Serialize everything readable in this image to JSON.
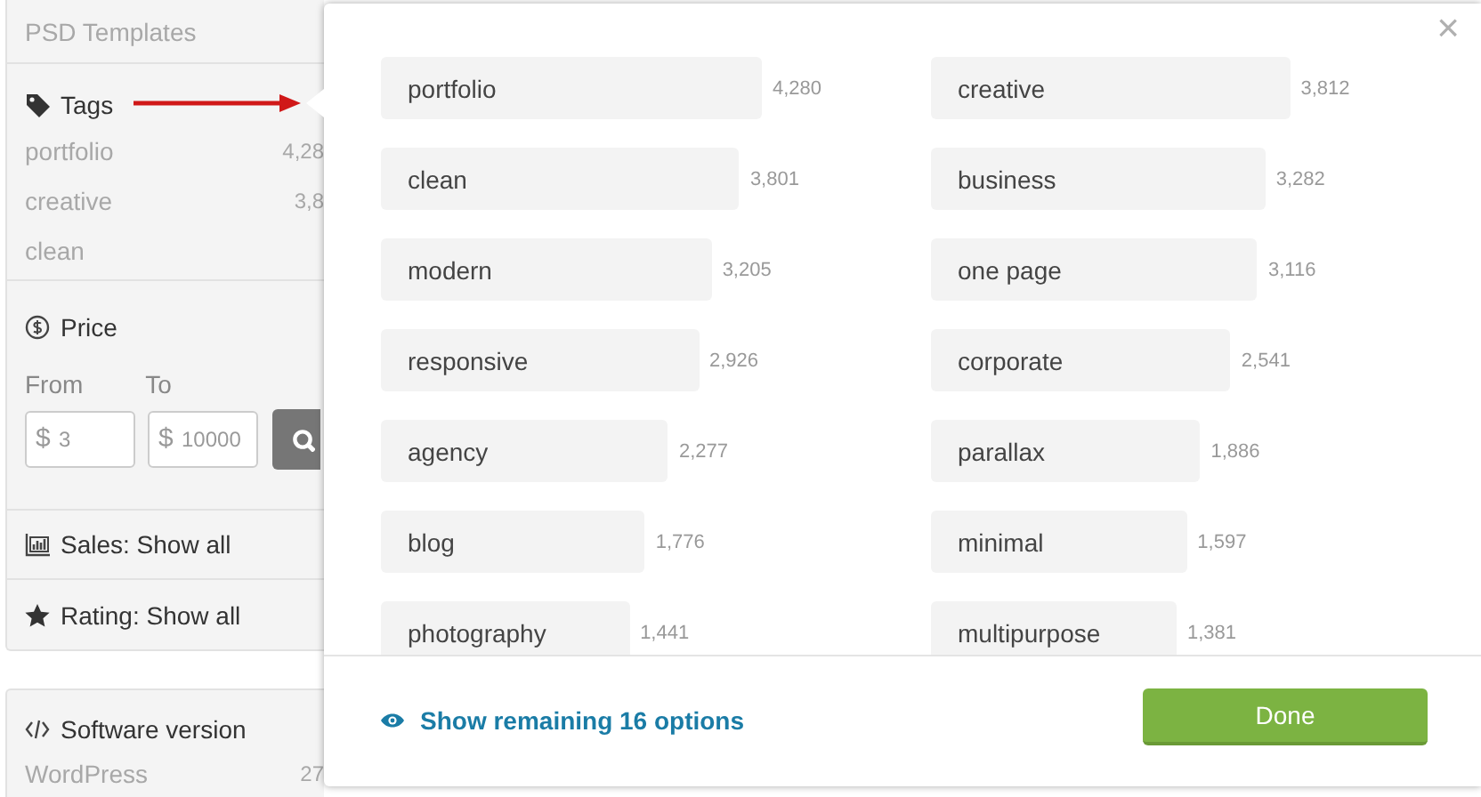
{
  "sidebar": {
    "category": {
      "label": "PSD Templates"
    },
    "tags": {
      "title": "Tags",
      "items": [
        {
          "label": "portfolio",
          "count": "4,28"
        },
        {
          "label": "creative",
          "count": "3,8"
        },
        {
          "label": "clean"
        }
      ]
    },
    "price": {
      "title": "Price",
      "from_label": "From",
      "to_label": "To",
      "from": {
        "currency": "$",
        "placeholder": "3"
      },
      "to": {
        "currency": "$",
        "placeholder": "10000"
      }
    },
    "sales": "Sales: Show all",
    "rating": "Rating: Show all",
    "software": {
      "title": "Software version",
      "items": [
        {
          "label": "WordPress",
          "count": "27"
        }
      ]
    }
  },
  "modal": {
    "close": "×",
    "tags": [
      {
        "label": "portfolio",
        "count": "4,280"
      },
      {
        "label": "creative",
        "count": "3,812"
      },
      {
        "label": "clean",
        "count": "3,801"
      },
      {
        "label": "business",
        "count": "3,282"
      },
      {
        "label": "modern",
        "count": "3,205"
      },
      {
        "label": "one page",
        "count": "3,116"
      },
      {
        "label": "responsive",
        "count": "2,926"
      },
      {
        "label": "corporate",
        "count": "2,541"
      },
      {
        "label": "agency",
        "count": "2,277"
      },
      {
        "label": "parallax",
        "count": "1,886"
      },
      {
        "label": "blog",
        "count": "1,776"
      },
      {
        "label": "minimal",
        "count": "1,597"
      },
      {
        "label": "photography",
        "count": "1,441"
      },
      {
        "label": "multipurpose",
        "count": "1,381"
      }
    ],
    "show_more": "Show remaining 16 options",
    "done": "Done"
  }
}
